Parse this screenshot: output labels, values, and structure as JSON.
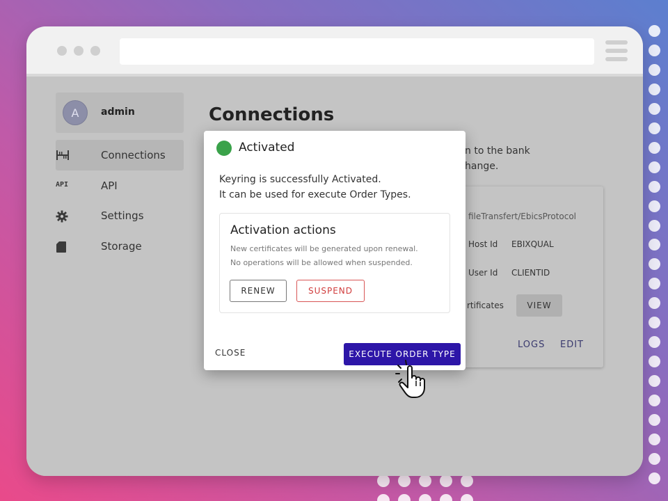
{
  "app": {
    "user": {
      "avatar_initial": "A",
      "name": "admin"
    },
    "nav": [
      {
        "label": "Connections",
        "icon": "connections-icon",
        "active": true
      },
      {
        "label": "API",
        "icon": "api-icon",
        "active": false
      },
      {
        "label": "Settings",
        "icon": "gear-icon",
        "active": false
      },
      {
        "label": "Storage",
        "icon": "sd-card-icon",
        "active": false
      }
    ],
    "api_icon_text": "API",
    "page_title": "Connections",
    "page_subtitle_lines": [
      "n to the bank",
      "hange."
    ],
    "card": {
      "path": "fileTransfert/EbicsProtocol",
      "host_label": "Host Id",
      "host_value": "EBIXQUAL",
      "user_label": "User Id",
      "user_value": "CLIENTID",
      "certs_label": "rtificates",
      "view_label": "VIEW",
      "logs_label": "LOGS",
      "edit_label": "EDIT"
    }
  },
  "modal": {
    "status_color": "#3aa24a",
    "title": "Activated",
    "message_line1": "Keyring is successfully Activated.",
    "message_line2": "It can be used for execute Order Types.",
    "panel": {
      "title": "Activation actions",
      "line1": "New certificates will be generated upon renewal.",
      "line2": "No operations will be allowed when suspended.",
      "renew_label": "RENEW",
      "suspend_label": "SUSPEND"
    },
    "close_label": "CLOSE",
    "execute_label": "EXECUTE ORDER TYPE"
  },
  "colors": {
    "primary_button": "#2d16a8",
    "danger": "#d03c3c",
    "success": "#3aa24a"
  }
}
